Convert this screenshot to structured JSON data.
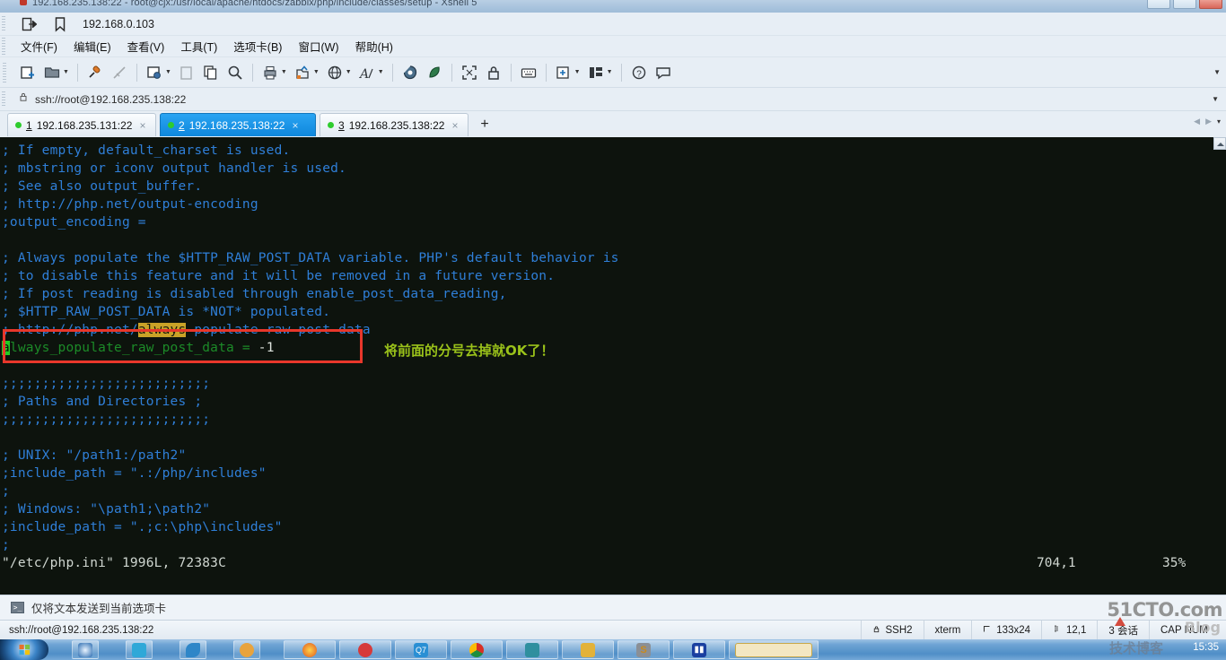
{
  "window": {
    "title": "192.168.235.138:22 - root@cjx:/usr/local/apache/htdocs/zabbix/php/include/classes/setup - Xshell 5",
    "controls": {
      "minimize": "_",
      "maximize": "❐",
      "close": "×"
    }
  },
  "quickbar": {
    "open_session_icon": "open-session-icon",
    "bookmark_icon": "bookmark-icon",
    "host": "192.168.0.103"
  },
  "menubar": {
    "items": [
      {
        "label": "文件(F)",
        "name": "menu-file"
      },
      {
        "label": "编辑(E)",
        "name": "menu-edit"
      },
      {
        "label": "查看(V)",
        "name": "menu-view"
      },
      {
        "label": "工具(T)",
        "name": "menu-tools"
      },
      {
        "label": "选项卡(B)",
        "name": "menu-tabs"
      },
      {
        "label": "窗口(W)",
        "name": "menu-window"
      },
      {
        "label": "帮助(H)",
        "name": "menu-help"
      }
    ]
  },
  "toolbar": {
    "items": [
      "new-session-icon",
      "open-folder-icon",
      "connect-icon",
      "disconnect-icon",
      "session-properties-icon",
      "paste-icon",
      "copy-icon",
      "find-icon",
      "print-icon",
      "file-transfer-icon",
      "globe-icon",
      "font-icon",
      "log-icon",
      "leaf-icon",
      "fullscreen-icon",
      "lock-icon",
      "keyboard-icon",
      "add-pane-icon",
      "layout-icon",
      "help-icon",
      "comment-icon"
    ]
  },
  "addressbar": {
    "lock_icon": "lock-icon",
    "value": "ssh://root@192.168.235.138:22",
    "dropdown_icon": "chevron-down-icon"
  },
  "tabs": {
    "items": [
      {
        "num": "1",
        "label": "192.168.235.131:22",
        "active": false,
        "status": "connected"
      },
      {
        "num": "2",
        "label": "192.168.235.138:22",
        "active": true,
        "status": "connected"
      },
      {
        "num": "3",
        "label": "192.168.235.138:22",
        "active": false,
        "status": "connected"
      }
    ],
    "add_label": "+",
    "nav_prev": "◀",
    "nav_next": "▶",
    "nav_menu": "▾"
  },
  "terminal": {
    "lines": [
      "; If empty, default_charset is used.",
      "; mbstring or iconv output handler is used.",
      "; See also output_buffer.",
      "; http://php.net/output-encoding",
      ";output_encoding =",
      "",
      "; Always populate the $HTTP_RAW_POST_DATA variable. PHP's default behavior is",
      "; to disable this feature and it will be removed in a future version.",
      "; If post reading is disabled through enable_post_data_reading,",
      "; $HTTP_RAW_POST_DATA is *NOT* populated."
    ],
    "highlight_line": {
      "prefix": "; http://php.net/",
      "match": "always",
      "suffix": "-populate-raw-post-data"
    },
    "edited_line": {
      "cursor_char": "a",
      "rest": "lways_populate_raw_post_data = ",
      "value": "-1"
    },
    "annotation": "将前面的分号去掉就OK了！",
    "lines_after": [
      ";;;;;;;;;;;;;;;;;;;;;;;;;;",
      "; Paths and Directories ;",
      ";;;;;;;;;;;;;;;;;;;;;;;;;;",
      "",
      "; UNIX: \"/path1:/path2\"",
      ";include_path = \".:/php/includes\"",
      ";",
      "; Windows: \"\\path1;\\path2\"",
      ";include_path = \".;c:\\php\\includes\"",
      ";"
    ],
    "vim_status": "\"/etc/php.ini\" 1996L, 72383C",
    "vim_position": "704,1",
    "vim_percent": "35%",
    "colors": {
      "background": "#0d130d",
      "comment": "#2f7fd8",
      "white_text": "#cfd6d0",
      "green_text": "#1c8b28",
      "cursor": "#22cc22",
      "search_highlight": "#c9a227",
      "annotation_box": "#e8372b",
      "annotation_text": "#9ac21a"
    }
  },
  "sendbar": {
    "icon": "send-to-tab-icon",
    "label": "仅将文本发送到当前选项卡"
  },
  "statusbar": {
    "session": "ssh://root@192.168.235.138:22",
    "security_icon": "lock-icon",
    "protocol": "SSH2",
    "terminal_type": "xterm",
    "size_icon": "resize-icon",
    "size": "133x24",
    "cursor_icon": "cursor-icon",
    "cursor": "12,1",
    "sessions": "3 会话",
    "caps": "CAP NUM"
  },
  "taskbar": {
    "start_icon": "windows-start-icon",
    "pinned": [
      {
        "name": "taskbar-item-explorer",
        "color": "#3a7fc4"
      },
      {
        "name": "taskbar-item-cloud",
        "color": "#2fa8d8"
      },
      {
        "name": "taskbar-item-bird",
        "color": "#2e86c8"
      },
      {
        "name": "taskbar-item-media",
        "color": "#e8a33d"
      },
      {
        "name": "taskbar-item-firefox",
        "color": "#e06a1e"
      },
      {
        "name": "taskbar-item-opera",
        "color": "#d63a3a"
      },
      {
        "name": "taskbar-item-qq",
        "color": "#2a8fd4"
      },
      {
        "name": "taskbar-item-chrome",
        "color": "#44a048"
      },
      {
        "name": "taskbar-item-xshell",
        "color": "#2f8f4f"
      },
      {
        "name": "taskbar-item-folder",
        "color": "#e2b23a"
      },
      {
        "name": "taskbar-item-s",
        "color": "#c98a1c"
      },
      {
        "name": "taskbar-item-chart",
        "color": "#1a3fa0"
      },
      {
        "name": "taskbar-item-doc",
        "color": "#e8c24a"
      }
    ],
    "clock": "15:35"
  },
  "watermark": {
    "site": "51CTO.com",
    "blog": "Blog",
    "chinese": "技术博客"
  }
}
